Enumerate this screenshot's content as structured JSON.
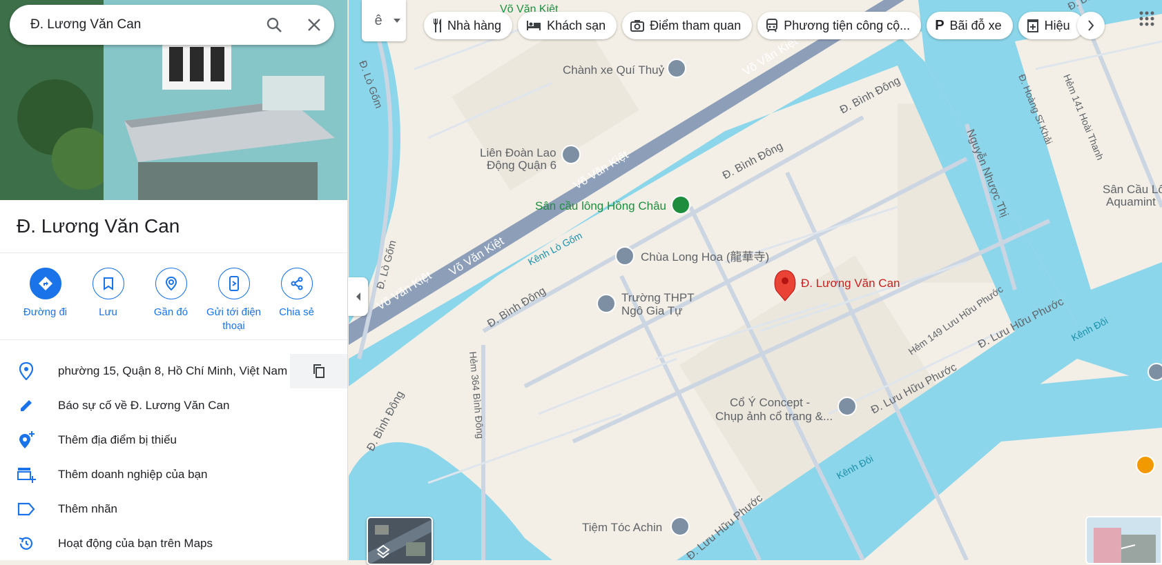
{
  "search": {
    "query": "Đ. Lương Văn Can"
  },
  "place": {
    "title": "Đ. Lương Văn Can"
  },
  "actions": [
    {
      "label": "Đường đi"
    },
    {
      "label": "Lưu"
    },
    {
      "label": "Gần đó"
    },
    {
      "label": "Gửi tới điện thoại"
    },
    {
      "label": "Chia sẻ"
    }
  ],
  "info_rows": [
    {
      "icon": "location-pin-icon",
      "text": "phường 15, Quận 8, Hồ Chí Minh, Việt Nam"
    },
    {
      "icon": "pencil-icon",
      "text": "Báo sự cố về Đ. Lương Văn Can"
    },
    {
      "icon": "add-place-icon",
      "text": "Thêm địa điểm bị thiếu"
    },
    {
      "icon": "add-business-icon",
      "text": "Thêm doanh nghiệp của bạn"
    },
    {
      "icon": "label-icon",
      "text": "Thêm nhãn"
    },
    {
      "icon": "history-icon",
      "text": "Hoạt động của bạn trên Maps"
    }
  ],
  "chips": [
    {
      "icon": "restaurant-icon",
      "label": "Nhà hàng"
    },
    {
      "icon": "hotel-icon",
      "label": "Khách sạn"
    },
    {
      "icon": "camera-icon",
      "label": "Điểm tham quan"
    },
    {
      "icon": "transit-icon",
      "label": "Phương tiện công cộ..."
    },
    {
      "icon": "parking-icon",
      "label": "Bãi đỗ xe"
    },
    {
      "icon": "pharmacy-icon",
      "label": "Hiệu"
    }
  ],
  "layer_switch": {
    "label": "ê"
  },
  "map": {
    "selected_pin": "Đ. Lương Văn Can",
    "roads": {
      "vo_van_kiet": "Võ Văn Kiệt",
      "binh_dong": "Đ. Bình Đông",
      "lo_gom": "Đ. Lò Gốm",
      "nguyen_nhuoc_thi": "Nguyễn Nhược Thị",
      "hoang_si_khai": "Đ. Hoàng Sĩ Khải",
      "hem_141": "Hẻm 141 Hoài Thanh",
      "hem_364": "Hẻm 364 Bình Đông",
      "hem_149": "Hẻm 149 Lưu Hữu Phước",
      "luu_huu_phuoc": "Đ. Lưu Hữu Phước"
    },
    "waterways": {
      "lo_gom": "Kênh Lò Gốm",
      "doi_1": "Kênh Đôi",
      "doi_2": "Kênh Đôi"
    },
    "pois": {
      "chanh_xe": "Chành xe Quí Thuỷ",
      "lien_doan_1": "Liên Đoàn Lao",
      "lien_doan_2": "Động Quận 6",
      "san_cau_long": "Sân cầu lông Hồng Châu",
      "chua": "Chùa Long Hoa (龍華寺)",
      "truong_1": "Trường THPT",
      "truong_2": "Ngô Gia Tự",
      "co_y_1": "Cổ Ý Concept -",
      "co_y_2": "Chụp ảnh cổ trang &...",
      "tiem_toc": "Tiệm Tóc Achin",
      "aqua_1": "Sân Cầu Lô",
      "aqua_2": "Aquamint",
      "top_vvk": "Võ Văn Kiệt",
      "top_right": "Đ. Bình Đông"
    }
  },
  "colors": {
    "accent": "#1a73e8",
    "pin": "#ea4335",
    "water": "#8bd6ea",
    "land": "#f3efe6",
    "road": "#ccd6e2",
    "highway": "#8c9eb8"
  }
}
